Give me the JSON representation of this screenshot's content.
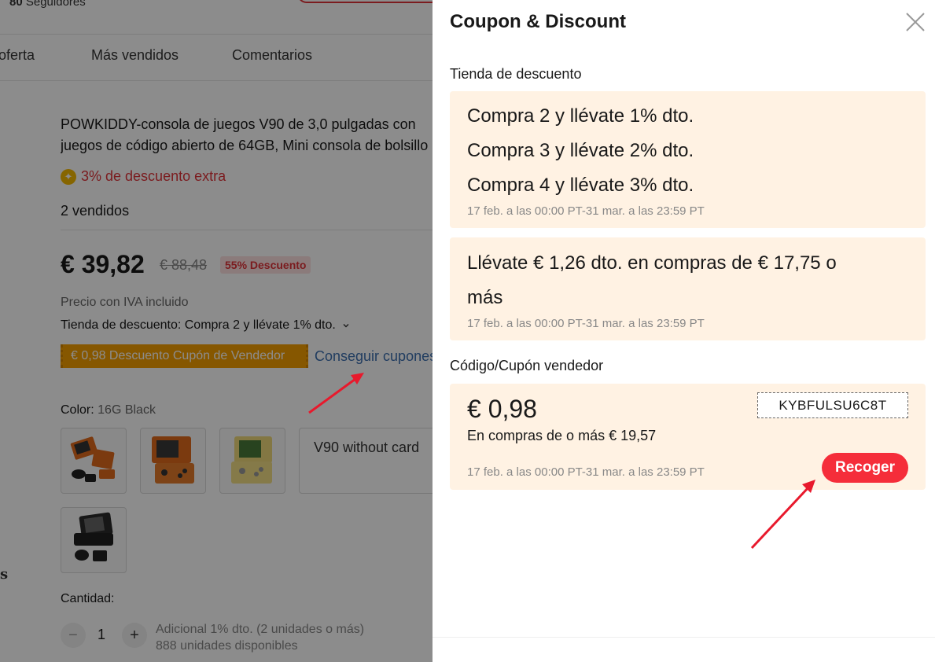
{
  "store": {
    "followers_count": "80",
    "followers_label": "Seguidores"
  },
  "tabs": [
    "oferta",
    "Más vendidos",
    "Comentarios"
  ],
  "product": {
    "title_line1": "POWKIDDY-consola de juegos V90 de 3,0 pulgadas con",
    "title_line2": "juegos de código abierto de 64GB, Mini consola de bolsillo",
    "extra_discount": "3% de descuento extra",
    "sold": "2 vendidos",
    "price": "€ 39,82",
    "old_price": "€ 88,48",
    "discount_badge": "55% Descuento",
    "vat_note": "Precio con IVA incluido",
    "store_discount": "Tienda de descuento: Compra 2 y llévate 1% dto.",
    "coupon_tag": "€ 0,98 Descuento Cupón de Vendedor",
    "get_coupon": "Conseguir cupones",
    "color_label": "Color:",
    "color_value": "16G Black",
    "variant_card": "V90 without card",
    "side_letter": "s",
    "quantity_label": "Cantidad:",
    "quantity_value": "1",
    "qty_minus": "−",
    "qty_plus": "+",
    "qty_note_1": "Adicional 1% dto. (2 unidades o más)",
    "qty_note_2": "888 unidades disponibles"
  },
  "drawer": {
    "title": "Coupon & Discount",
    "store_discount_label": "Tienda de descuento",
    "tiers": [
      "Compra 2 y llévate 1% dto.",
      "Compra 3 y llévate 2% dto.",
      "Compra 4 y llévate 3% dto."
    ],
    "tiers_period": "17 feb. a las 00:00 PT-31 mar. a las 23:59 PT",
    "threshold_line1": "Llévate € 1,26 dto. en compras de € 17,75 o",
    "threshold_line2": "más",
    "threshold_period": "17 feb. a las 00:00 PT-31 mar. a las 23:59 PT",
    "seller_coupon_label": "Código/Cupón vendedor",
    "coupon": {
      "amount": "€ 0,98",
      "min_purchase": "En compras de o más € 19,57",
      "code": "KYBFULSU6C8T",
      "period": "17 feb. a las 00:00 PT-31 mar. a las 23:59 PT",
      "collect_label": "Recoger"
    }
  },
  "colors": {
    "accent_red": "#f52d3a",
    "coupon_card_bg": "#fff2e3",
    "coupon_tag_bg": "#f59f00",
    "link_blue": "#3d6fb0",
    "annotation_arrow": "#e8192c"
  },
  "icons": {
    "close": "close-icon",
    "coin": "coin-icon",
    "chevron": "chevron-down-icon"
  }
}
